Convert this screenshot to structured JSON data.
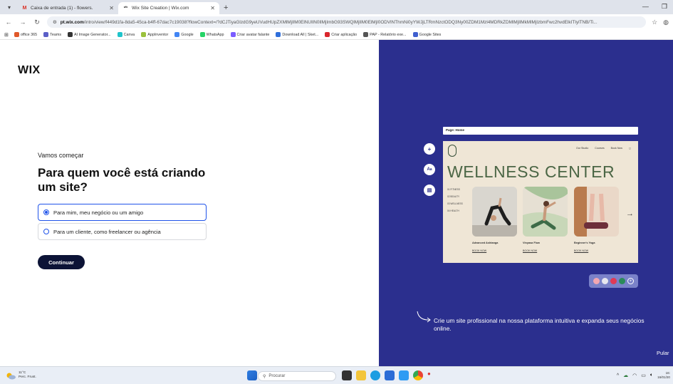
{
  "browser": {
    "tabs": [
      {
        "title": "Caixa de entrada (1) - flowers.",
        "active": false,
        "favicon": "gmail-icon"
      },
      {
        "title": "Wix Site Creation | Wix.com",
        "active": true,
        "favicon": "wix-icon"
      }
    ],
    "new_tab": "+",
    "url_host": "pt.wix.com",
    "url_path": "/intro/view/f449d1fa-8da5-45ca-b4ff-67dac7c19038?flowContext=/?dCJTiyaGlzdG9yeUVudHUpZXMlMjIlM0ElNUIlN0IlMjImbG93SWQlMjIlM0ElMjI0ODVlNThmNi0yYWJjLTRmNzctODQ3Ny00ZDM1Mzl4MDRkZDMlMjIlMkMlMjIzbmFwc2hvdElkITIylTNB/Ti...",
    "bookmarks": [
      {
        "label": "office 365",
        "color": "#e0592a"
      },
      {
        "label": "Teams",
        "color": "#5b5fc7"
      },
      {
        "label": "AI Image Generator...",
        "color": "#333333"
      },
      {
        "label": "Canva",
        "color": "#20c4cb"
      },
      {
        "label": "AppInventor",
        "color": "#9bc13c"
      },
      {
        "label": "Google",
        "color": "#4285f4"
      },
      {
        "label": "WhatsApp",
        "color": "#25d366"
      },
      {
        "label": "Criar avatar falante",
        "color": "#7a5cff"
      },
      {
        "label": "Download All | Sket...",
        "color": "#2f6fdb"
      },
      {
        "label": "Criar aplicação",
        "color": "#d9262c"
      },
      {
        "label": "PAP - Relatório exe...",
        "color": "#555555"
      },
      {
        "label": "Google Sites",
        "color": "#3f5fcf"
      }
    ]
  },
  "left": {
    "logo": "WIX",
    "lead": "Vamos começar",
    "question": "Para quem você está criando um site?",
    "options": [
      {
        "label": "Para mim, meu negócio ou um amigo",
        "selected": true
      },
      {
        "label": "Para um cliente, como freelancer ou agência",
        "selected": false
      }
    ],
    "cta": "Continuar"
  },
  "right": {
    "preview_bar": "Page: Home",
    "site": {
      "nav": [
        "Our Studio",
        "Courses",
        "Book Now"
      ],
      "headline": "WELLNESS CENTER",
      "categories": [
        "01  FITNESS",
        "02  BEAUTY",
        "03  WELLNESS",
        "04  HEALTH"
      ],
      "cards": [
        {
          "caption": "Advanced Ashtanga",
          "link": "BOOK NOW"
        },
        {
          "caption": "Vinyasa Flow",
          "link": "BOOK NOW"
        },
        {
          "caption": "Beginner's Yoga",
          "link": "BOOK NOW"
        }
      ]
    },
    "palette": [
      "#f2a7b2",
      "#e7e7ee",
      "#e03a55",
      "#2a8b5a"
    ],
    "tagline": "Crie um site profissional na nossa plataforma intuitiva e expanda seus negócios online.",
    "skip": "Pular"
  },
  "taskbar": {
    "temp": "11°C",
    "weather": "Perc. Frust.",
    "search_placeholder": "Procurar",
    "time": "16:",
    "date": "16/01/20"
  }
}
